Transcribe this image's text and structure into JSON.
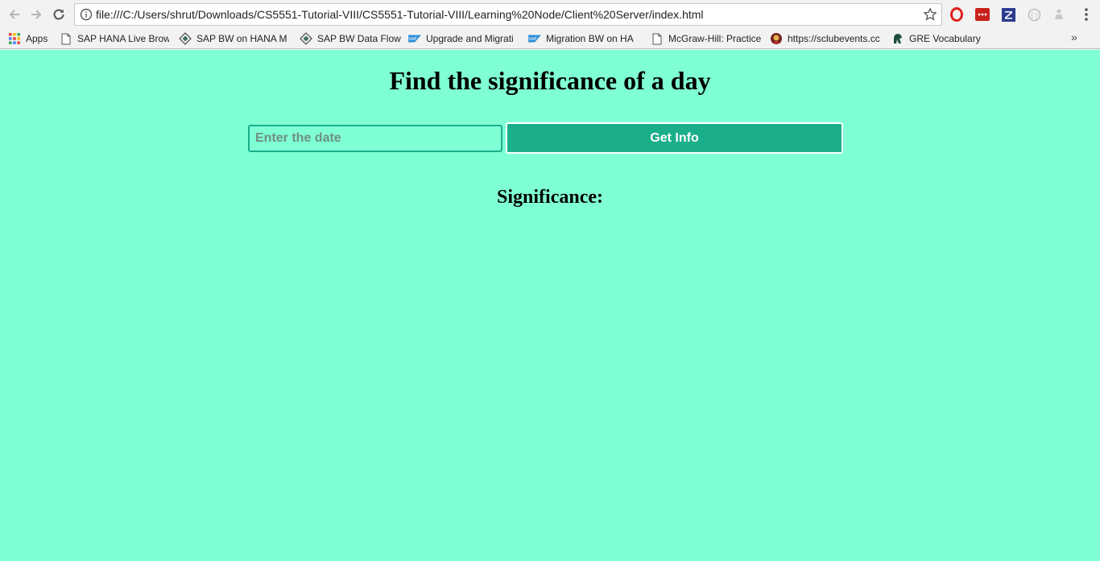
{
  "browser": {
    "url": "file:///C:/Users/shrut/Downloads/CS5551-Tutorial-VIII/CS5551-Tutorial-VIII/Learning%20Node/Client%20Server/index.html",
    "bookmarks": [
      {
        "label": "Apps",
        "icon": "apps-grid-icon"
      },
      {
        "label": "SAP HANA Live Brow",
        "icon": "page-icon"
      },
      {
        "label": "SAP BW on HANA M",
        "icon": "diamond-icon"
      },
      {
        "label": "SAP BW Data Flow",
        "icon": "diamond-icon"
      },
      {
        "label": "Upgrade and Migrati",
        "icon": "sap-icon"
      },
      {
        "label": "Migration BW on HA",
        "icon": "sap-icon"
      },
      {
        "label": "McGraw-Hill: Practice",
        "icon": "page-icon"
      },
      {
        "label": "https://sclubevents.cc",
        "icon": "mascot-icon"
      },
      {
        "label": "GRE Vocabulary",
        "icon": "spartan-icon"
      }
    ],
    "more_label": "»",
    "extensions": [
      "opera-icon",
      "lastpass-icon",
      "zotero-icon",
      "circle-ext-icon",
      "person-ext-icon"
    ]
  },
  "page": {
    "title": "Find the significance of a day",
    "date_placeholder": "Enter the date",
    "date_value": "",
    "button_label": "Get Info",
    "significance_label": "Significance:"
  },
  "colors": {
    "page_background": "#7fffd4",
    "button_background": "#1aaf8a",
    "input_border": "#1aaf8a"
  }
}
